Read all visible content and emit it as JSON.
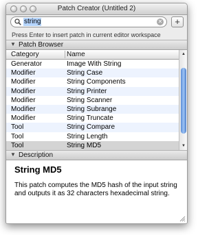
{
  "window": {
    "title": "Patch Creator (Untitled 2)"
  },
  "search": {
    "value": "string",
    "add_label": "+"
  },
  "hint": "Press Enter to insert patch in current editor workspace",
  "patch_browser": {
    "header": "Patch Browser",
    "columns": {
      "category": "Category",
      "name": "Name"
    },
    "rows": [
      {
        "category": "Generator",
        "name": "Image With String"
      },
      {
        "category": "Modifier",
        "name": "String Case"
      },
      {
        "category": "Modifier",
        "name": "String Components"
      },
      {
        "category": "Modifier",
        "name": "String Printer"
      },
      {
        "category": "Modifier",
        "name": "String Scanner"
      },
      {
        "category": "Modifier",
        "name": "String Subrange"
      },
      {
        "category": "Modifier",
        "name": "String Truncate"
      },
      {
        "category": "Tool",
        "name": "String Compare"
      },
      {
        "category": "Tool",
        "name": "String Length"
      },
      {
        "category": "Tool",
        "name": "String MD5"
      }
    ],
    "selected_row": "String MD5"
  },
  "description": {
    "header": "Description",
    "title": "String MD5",
    "text": "This patch computes the MD5 hash of the input string and outputs it as 32 characters hexadecimal string."
  },
  "colors": {
    "row_alt": "#edf3fe",
    "selection": "#d4d4d4",
    "search_highlight": "#b5d5ff",
    "scroll_thumb": "#6f9fe2"
  },
  "icons": [
    "close-window-icon",
    "minimize-window-icon",
    "zoom-window-icon",
    "search-icon",
    "clear-search-icon",
    "disclosure-triangle-icon",
    "resize-grip-icon"
  ]
}
